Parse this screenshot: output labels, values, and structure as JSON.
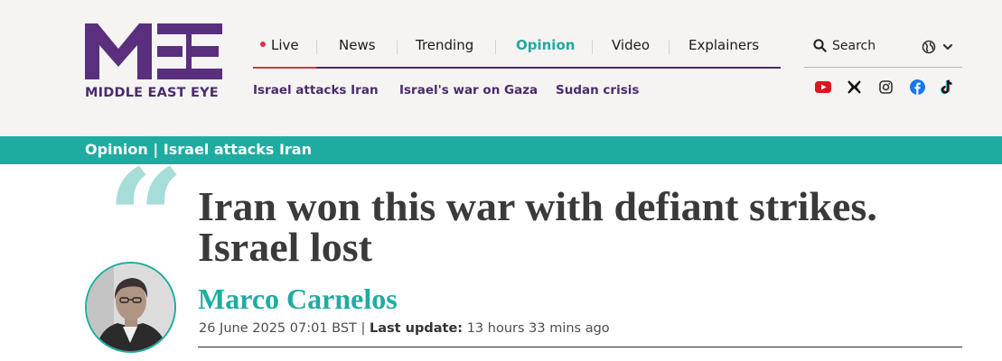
{
  "brand": {
    "name": "MIDDLE EAST EYE",
    "color": "#4a2b6b",
    "accent": "#1eaca1"
  },
  "primary_nav": [
    {
      "label": "Live",
      "live": true
    },
    {
      "label": "News"
    },
    {
      "label": "Trending"
    },
    {
      "label": "Opinion",
      "active": true
    },
    {
      "label": "Video"
    },
    {
      "label": "Explainers"
    }
  ],
  "secondary_nav": [
    "Israel attacks Iran",
    "Israel's war on Gaza",
    "Sudan crisis"
  ],
  "search": {
    "label": "Search",
    "icon": "search-icon"
  },
  "language_icon": "globe-icon",
  "socials": [
    "youtube-icon",
    "x-icon",
    "instagram-icon",
    "facebook-icon",
    "tiktok-icon"
  ],
  "breadcrumb": {
    "section": "Opinion",
    "separator": " | ",
    "topic": "Israel attacks Iran"
  },
  "article": {
    "quote_mark": "“",
    "headline_line1": "Iran won this war with defiant strikes.",
    "headline_line2": "Israel lost",
    "author": "Marco Carnelos",
    "published": "26 June 2025 07:01 BST",
    "separator": " | ",
    "last_update_label": "Last update:",
    "last_update_value": " 13 hours 33 mins ago"
  }
}
